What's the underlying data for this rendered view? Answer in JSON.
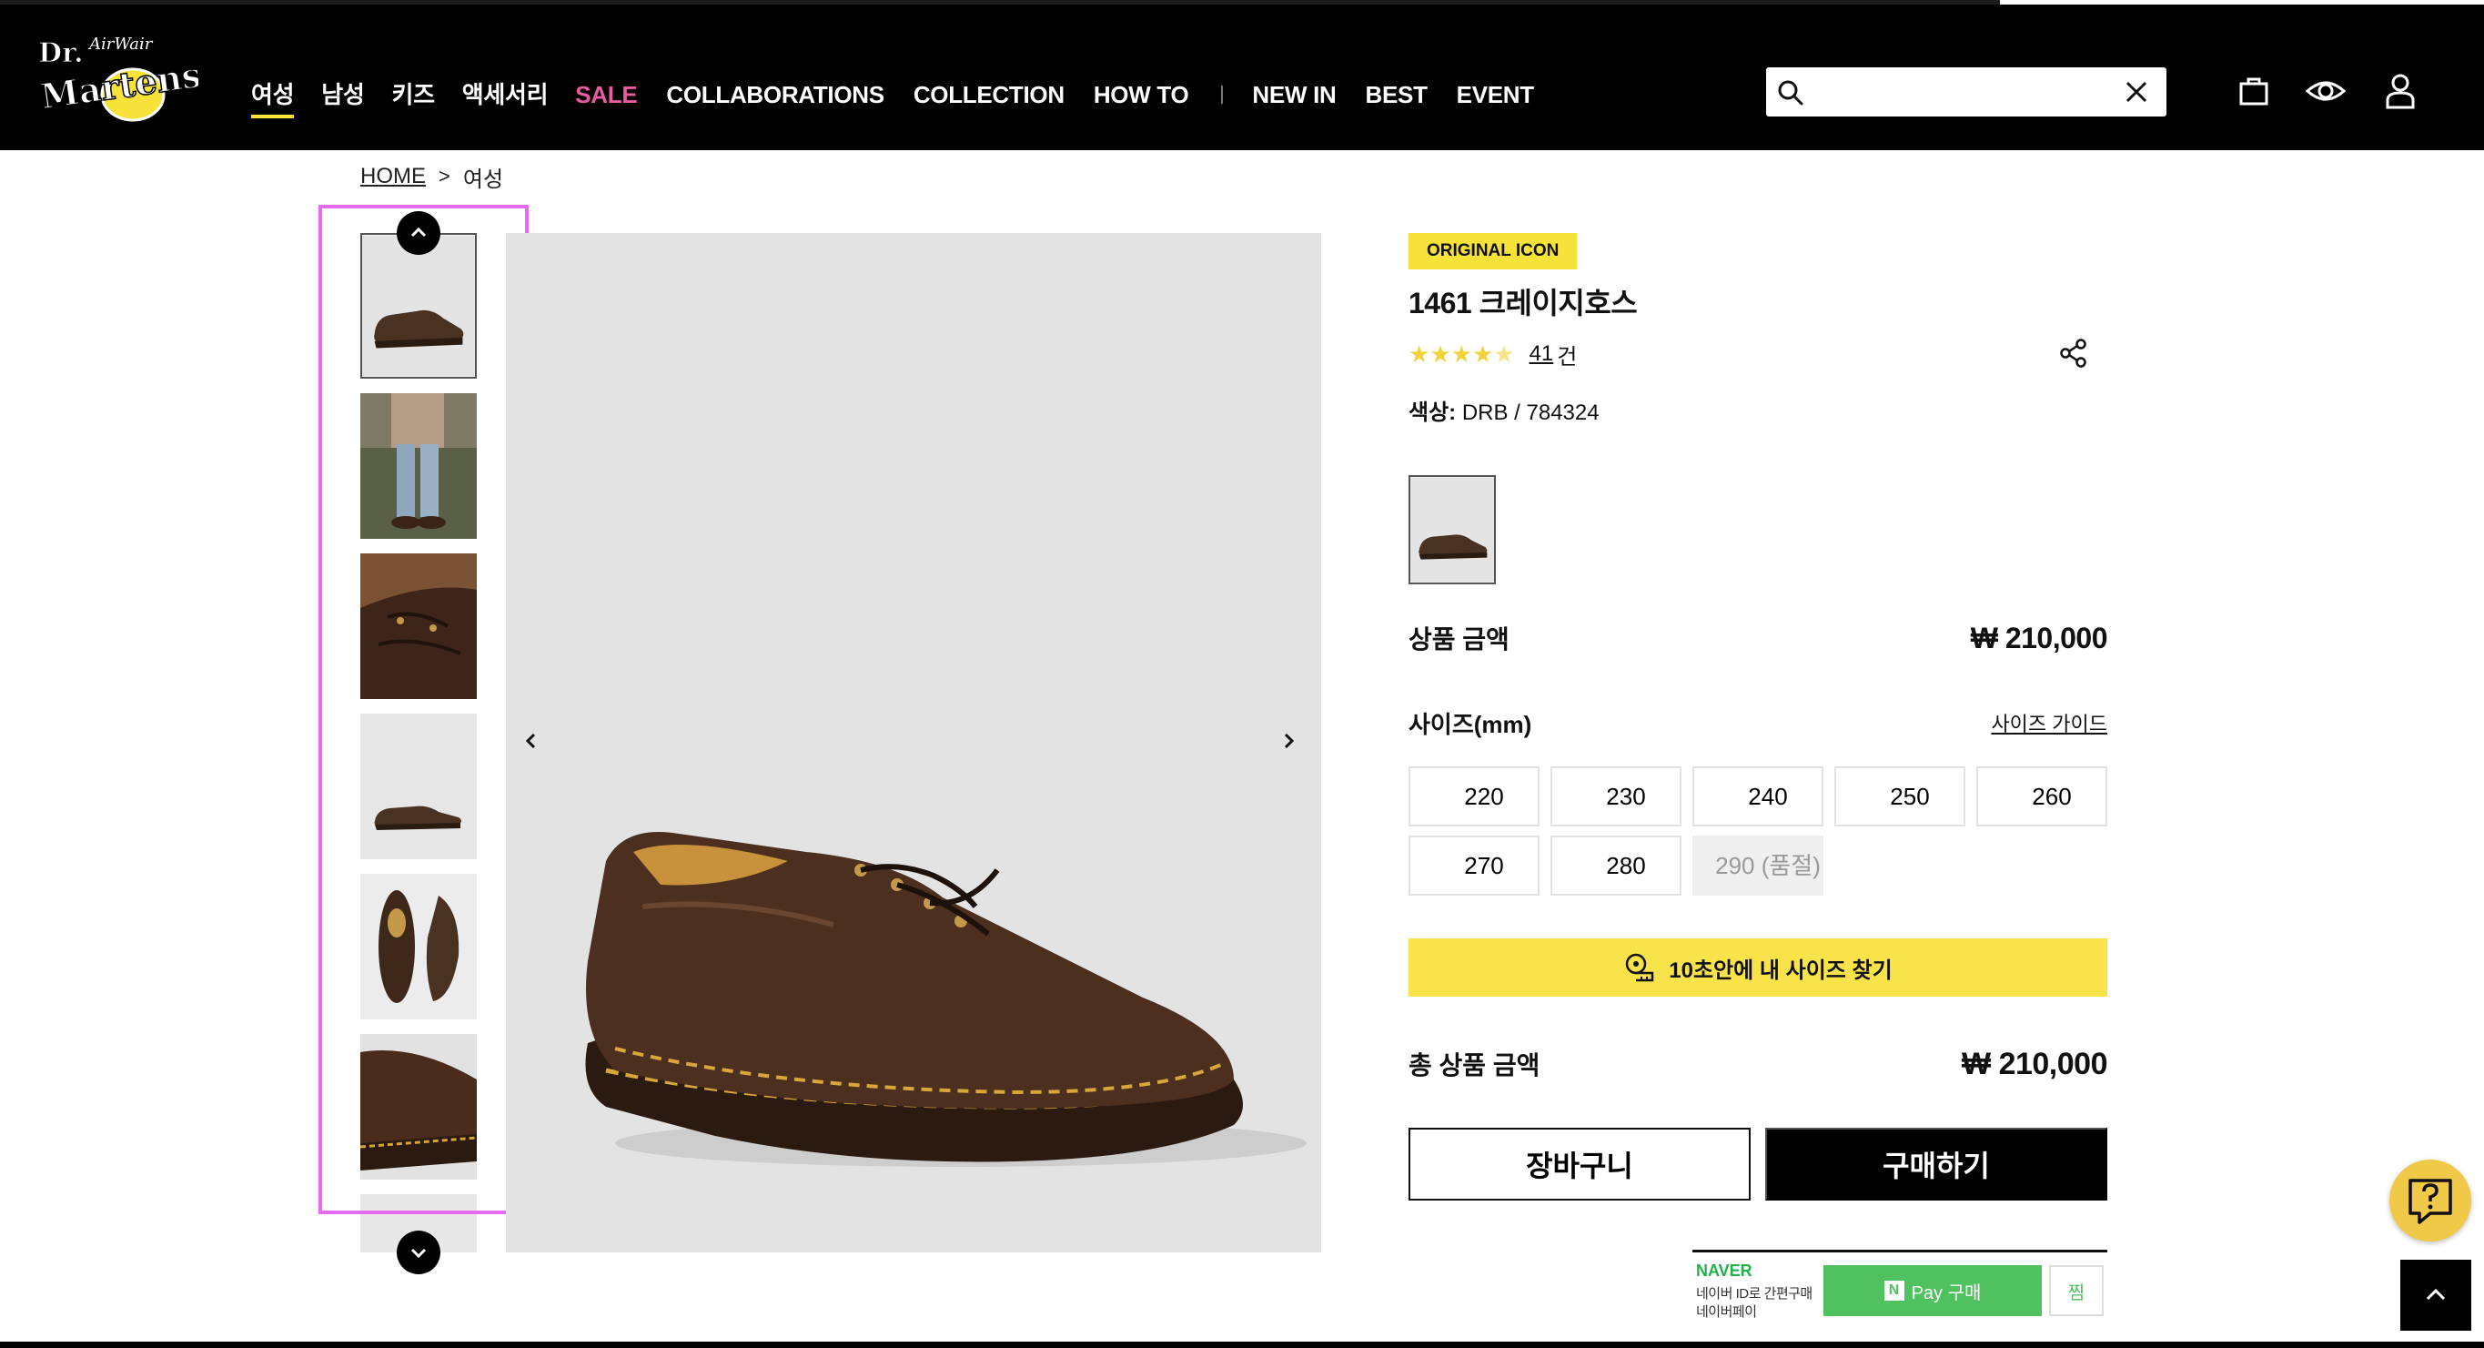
{
  "header": {
    "logo_alt": "Dr. Martens AirWair",
    "nav": [
      {
        "label": "여성",
        "active": true
      },
      {
        "label": "남성"
      },
      {
        "label": "키즈"
      },
      {
        "label": "액세서리"
      },
      {
        "label": "SALE",
        "sale": true
      },
      {
        "label": "COLLABORATIONS"
      },
      {
        "label": "COLLECTION"
      },
      {
        "label": "HOW TO"
      },
      {
        "label": "NEW IN"
      },
      {
        "label": "BEST"
      },
      {
        "label": "EVENT"
      }
    ],
    "search": {
      "value": "",
      "placeholder": ""
    },
    "icons": [
      "search-icon",
      "close-icon",
      "shopping-bag-icon",
      "eye-icon",
      "user-icon"
    ],
    "sale_color": "#e85ba1",
    "accent_color": "#f6e239"
  },
  "breadcrumb": {
    "home": "HOME",
    "separator": ">",
    "current": "여성"
  },
  "gallery": {
    "thumbnails": [
      "shoe-side-view",
      "model-wearing-shoes",
      "shoe-laces-closeup",
      "shoe-side-small",
      "shoe-top-view-pair",
      "shoe-heel-closeup",
      "shoe-partial"
    ],
    "selected_index": 0
  },
  "product": {
    "badge": "ORIGINAL ICON",
    "name": "1461 크레이지호스",
    "rating": 4.5,
    "review_count": "41",
    "review_unit": "건",
    "color_label": "색상:",
    "color_value": "DRB / 784324",
    "price_label": "상품 금액",
    "price": "₩ 210,000",
    "size_title": "사이즈(mm)",
    "size_guide": "사이즈 가이드",
    "sizes": [
      {
        "label": "220",
        "soldout": false
      },
      {
        "label": "230",
        "soldout": false
      },
      {
        "label": "240",
        "soldout": false
      },
      {
        "label": "250",
        "soldout": false
      },
      {
        "label": "260",
        "soldout": false
      },
      {
        "label": "270",
        "soldout": false
      },
      {
        "label": "280",
        "soldout": false
      },
      {
        "label": "290 (품절)",
        "soldout": true
      }
    ],
    "find_size": "10초안에 내 사이즈 찾기",
    "total_label": "총 상품 금액",
    "total_price": "₩ 210,000",
    "cart_button": "장바구니",
    "buy_button": "구매하기"
  },
  "naver_pay": {
    "brand": "NAVER",
    "line1": "네이버 ID로 간편구매",
    "line2": "네이버페이",
    "pay_button": "Pay 구매",
    "n_mark": "N",
    "zzim": "찜"
  }
}
